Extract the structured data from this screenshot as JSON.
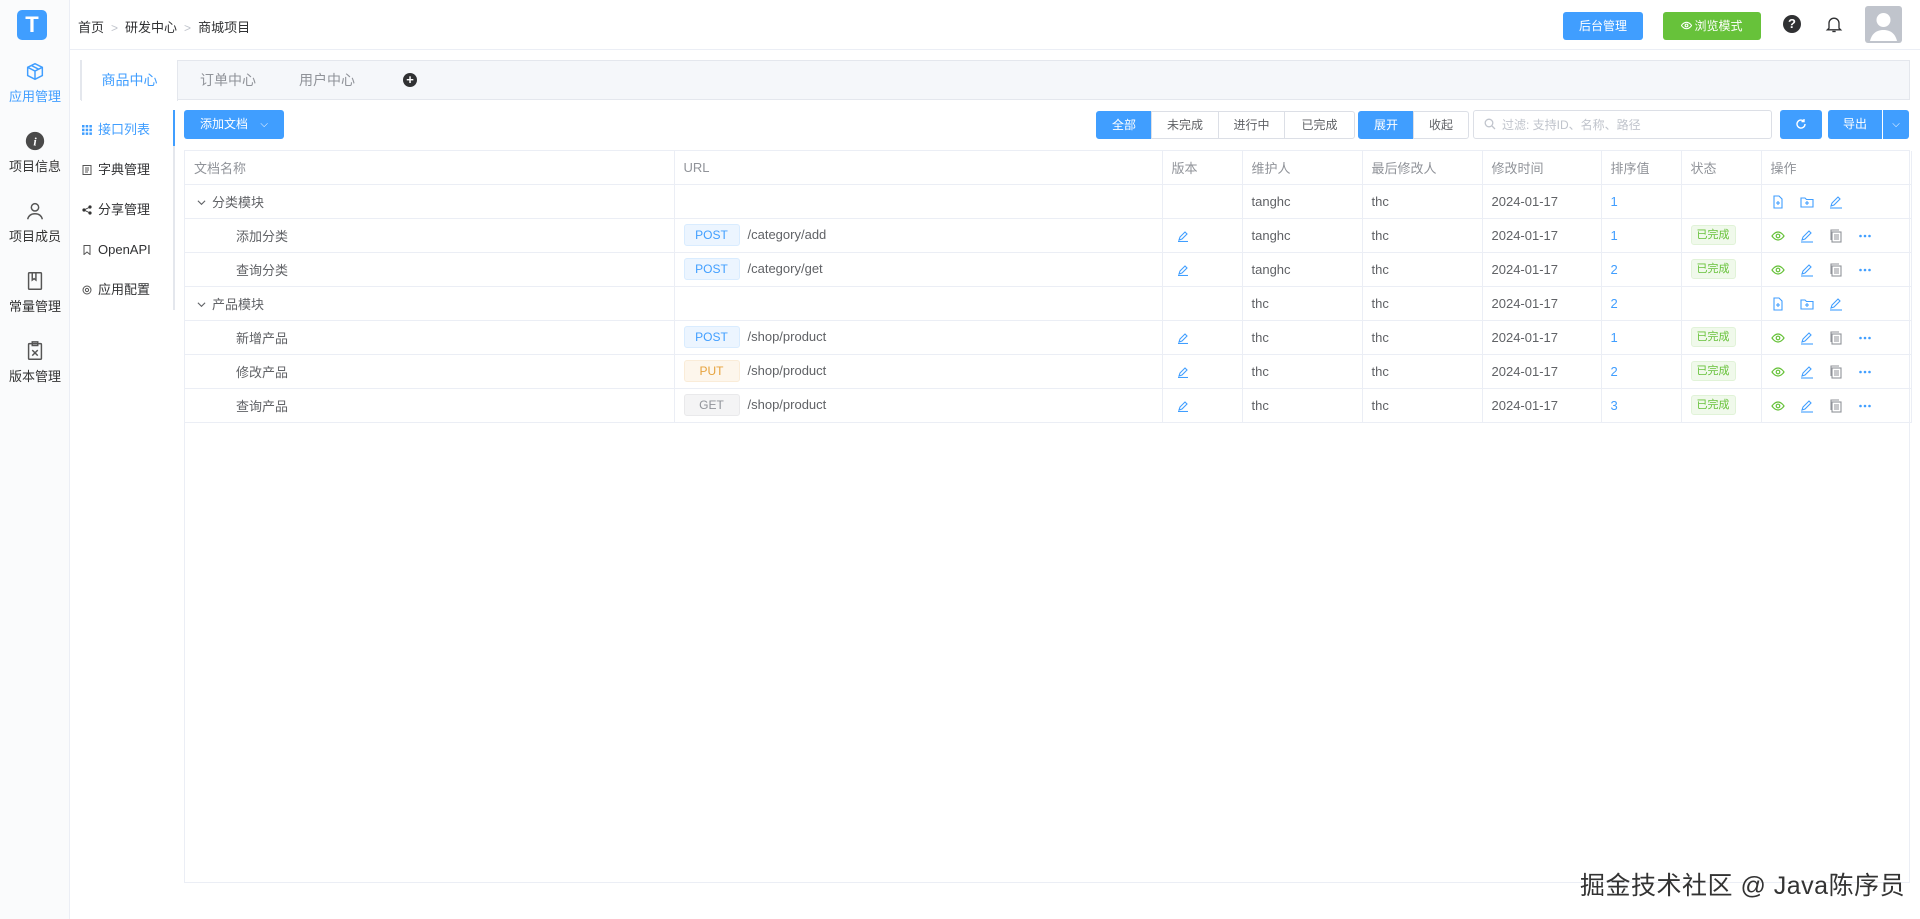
{
  "rail": {
    "logo_letter": "T",
    "items": [
      {
        "label": "应用管理",
        "icon": "box-icon",
        "active": true
      },
      {
        "label": "项目信息",
        "icon": "info-icon"
      },
      {
        "label": "项目成员",
        "icon": "user-icon"
      },
      {
        "label": "常量管理",
        "icon": "book-icon"
      },
      {
        "label": "版本管理",
        "icon": "version-icon"
      }
    ]
  },
  "topbar": {
    "breadcrumb": [
      "首页",
      "研发中心",
      "商城项目"
    ],
    "admin_label": "后台管理",
    "browse_label": "浏览模式",
    "help_glyph": "?"
  },
  "module_tabs": [
    "商品中心",
    "订单中心",
    "用户中心"
  ],
  "active_module": "商品中心",
  "subnav": [
    {
      "label": "接口列表",
      "icon": "grid-icon",
      "active": true
    },
    {
      "label": "字典管理",
      "icon": "document-icon"
    },
    {
      "label": "分享管理",
      "icon": "share-icon"
    },
    {
      "label": "OpenAPI",
      "icon": "bookmark-icon"
    },
    {
      "label": "应用配置",
      "icon": "settings-icon"
    }
  ],
  "toolbar": {
    "add_doc_label": "添加文档",
    "status_filters": [
      "全部",
      "未完成",
      "进行中",
      "已完成"
    ],
    "active_status": "全部",
    "expand_label": "展开",
    "collapse_label": "收起",
    "filter_placeholder": "过滤: 支持ID、名称、路径",
    "export_label": "导出"
  },
  "table": {
    "columns": [
      "文档名称",
      "URL",
      "版本",
      "维护人",
      "最后修改人",
      "修改时间",
      "排序值",
      "状态",
      "操作"
    ],
    "rows": [
      {
        "type": "group",
        "name": "分类模块",
        "maintainer": "tanghc",
        "modifier": "thc",
        "time": "2024-01-17",
        "sort": "1"
      },
      {
        "type": "child",
        "name": "添加分类",
        "method": "POST",
        "path": "/category/add",
        "maintainer": "tanghc",
        "modifier": "thc",
        "time": "2024-01-17",
        "sort": "1",
        "status": "已完成"
      },
      {
        "type": "child",
        "name": "查询分类",
        "method": "POST",
        "path": "/category/get",
        "maintainer": "tanghc",
        "modifier": "thc",
        "time": "2024-01-17",
        "sort": "2",
        "status": "已完成"
      },
      {
        "type": "group",
        "name": "产品模块",
        "maintainer": "thc",
        "modifier": "thc",
        "time": "2024-01-17",
        "sort": "2"
      },
      {
        "type": "child",
        "name": "新增产品",
        "method": "POST",
        "path": "/shop/product",
        "maintainer": "thc",
        "modifier": "thc",
        "time": "2024-01-17",
        "sort": "1",
        "status": "已完成"
      },
      {
        "type": "child",
        "name": "修改产品",
        "method": "PUT",
        "path": "/shop/product",
        "maintainer": "thc",
        "modifier": "thc",
        "time": "2024-01-17",
        "sort": "2",
        "status": "已完成"
      },
      {
        "type": "child",
        "name": "查询产品",
        "method": "GET",
        "path": "/shop/product",
        "maintainer": "thc",
        "modifier": "thc",
        "time": "2024-01-17",
        "sort": "3",
        "status": "已完成"
      }
    ]
  },
  "watermark": "掘金技术社区 @ Java陈序员",
  "colors": {
    "primary": "#409eff",
    "success": "#67c23a",
    "warning": "#e6a23c"
  }
}
